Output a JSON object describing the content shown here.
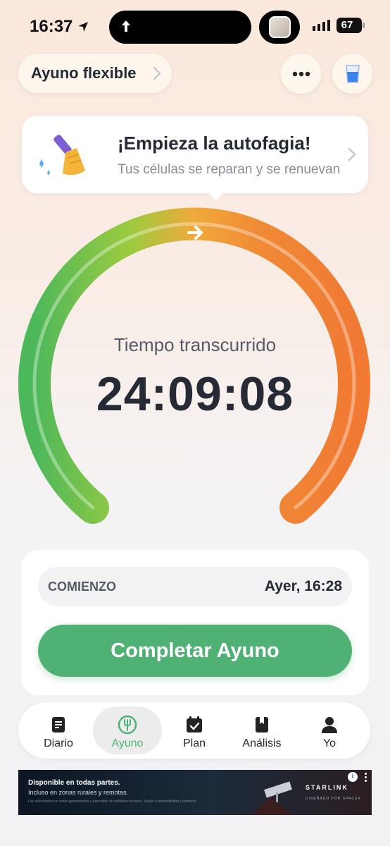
{
  "status_bar": {
    "time": "16:37",
    "battery": "67"
  },
  "header": {
    "plan_label": "Ayuno flexible",
    "more_icon": "more-icon",
    "water_icon": "water-glass-icon"
  },
  "tip": {
    "title": "¡Empieza la autofagia!",
    "subtitle": "Tus células se reparan y se renuevan",
    "icon": "broom-icon"
  },
  "timer": {
    "label": "Tiempo transcurrido",
    "value": "24:09:08",
    "progress_fraction": 1.0
  },
  "fast": {
    "start_label": "COMIENZO",
    "start_value": "Ayer, 16:28",
    "complete_label": "Completar Ayuno"
  },
  "tabs": [
    {
      "label": "Diario",
      "icon": "journal-icon",
      "active": false
    },
    {
      "label": "Ayuno",
      "icon": "fork-icon",
      "active": true
    },
    {
      "label": "Plan",
      "icon": "calendar-check-icon",
      "active": false
    },
    {
      "label": "Análisis",
      "icon": "bookmark-book-icon",
      "active": false
    },
    {
      "label": "Yo",
      "icon": "person-icon",
      "active": false
    }
  ],
  "ad": {
    "title": "Disponible en todas partes.",
    "subtitle": "Incluso en zonas rurales y remotas.",
    "fine_print": "Las velocidades no están garantizadas y dependen de múltiples factores. Sujeto a disponibilidad y términos.",
    "brand": "STARLINK",
    "brand_sub": "DISEÑADO POR SPACEX"
  },
  "colors": {
    "accent_green": "#4fb274",
    "gauge_start": "#4db85a",
    "gauge_mid": "#f0a93a",
    "gauge_end": "#f07a33"
  }
}
